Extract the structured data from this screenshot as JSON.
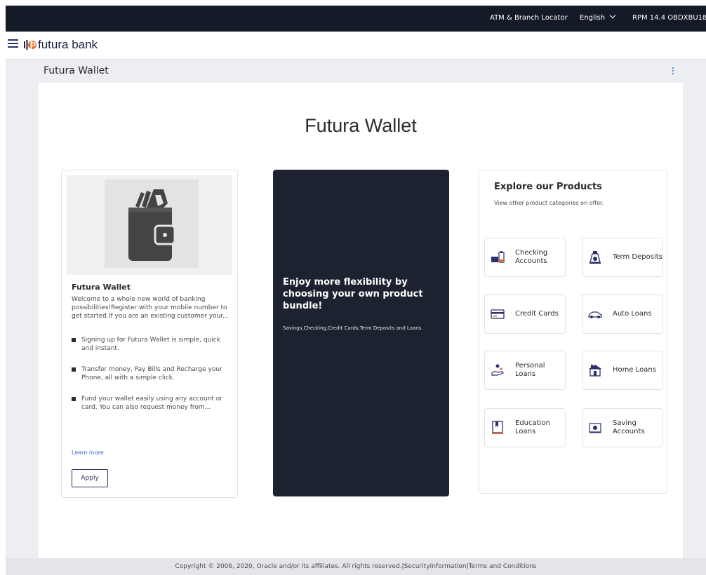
{
  "topbar": {
    "atm_locator": "ATM & Branch Locator",
    "language": "English",
    "user": "RPM 14.4 OBDXBU18"
  },
  "header": {
    "logo_text": "futura bank"
  },
  "page": {
    "title": "Futura Wallet",
    "heading": "Futura Wallet"
  },
  "wallet_card": {
    "title": "Futura Wallet",
    "description": "Welcome to a whole new world of banking possibilities!Register with your mobile number to get started.If you are an existing customer your...",
    "bullets": [
      "Signing up for Futura Wallet is simple, quick and instant.",
      "Transfer money, Pay Bills and Recharge your Phone, all with a simple click.",
      "Fund your wallet easily using any account or card. You can also request money from..."
    ],
    "learn_more": "Learn more",
    "apply": "Apply"
  },
  "promo_card": {
    "title": "Enjoy more flexibility by choosing your own product bundle!",
    "subtitle": "Savings,Checking,Credit Cards,Term Deposits and Loans."
  },
  "products": {
    "title": "Explore our Products",
    "subtitle": "View other product categories on offer.",
    "items": [
      {
        "label": "Checking Accounts",
        "icon": "checking-accounts-icon"
      },
      {
        "label": "Term Deposits",
        "icon": "term-deposits-icon"
      },
      {
        "label": "Credit Cards",
        "icon": "credit-card-icon"
      },
      {
        "label": "Auto Loans",
        "icon": "car-icon"
      },
      {
        "label": "Personal Loans",
        "icon": "personal-loan-icon"
      },
      {
        "label": "Home Loans",
        "icon": "house-icon"
      },
      {
        "label": "Education Loans",
        "icon": "book-icon"
      },
      {
        "label": "Saving Accounts",
        "icon": "saving-accounts-icon"
      }
    ]
  },
  "footer": {
    "copyright": "Copyright © 2006, 2020, Oracle and/or its affiliates. All rights reserved.|SecurityInformation|Terms and Conditions"
  },
  "colors": {
    "topbar": "#151a28",
    "brand": "#2b2f6a",
    "link": "#2c6fd6",
    "promo_bg": "#1d2230",
    "accent_orange": "#d86a3a"
  }
}
